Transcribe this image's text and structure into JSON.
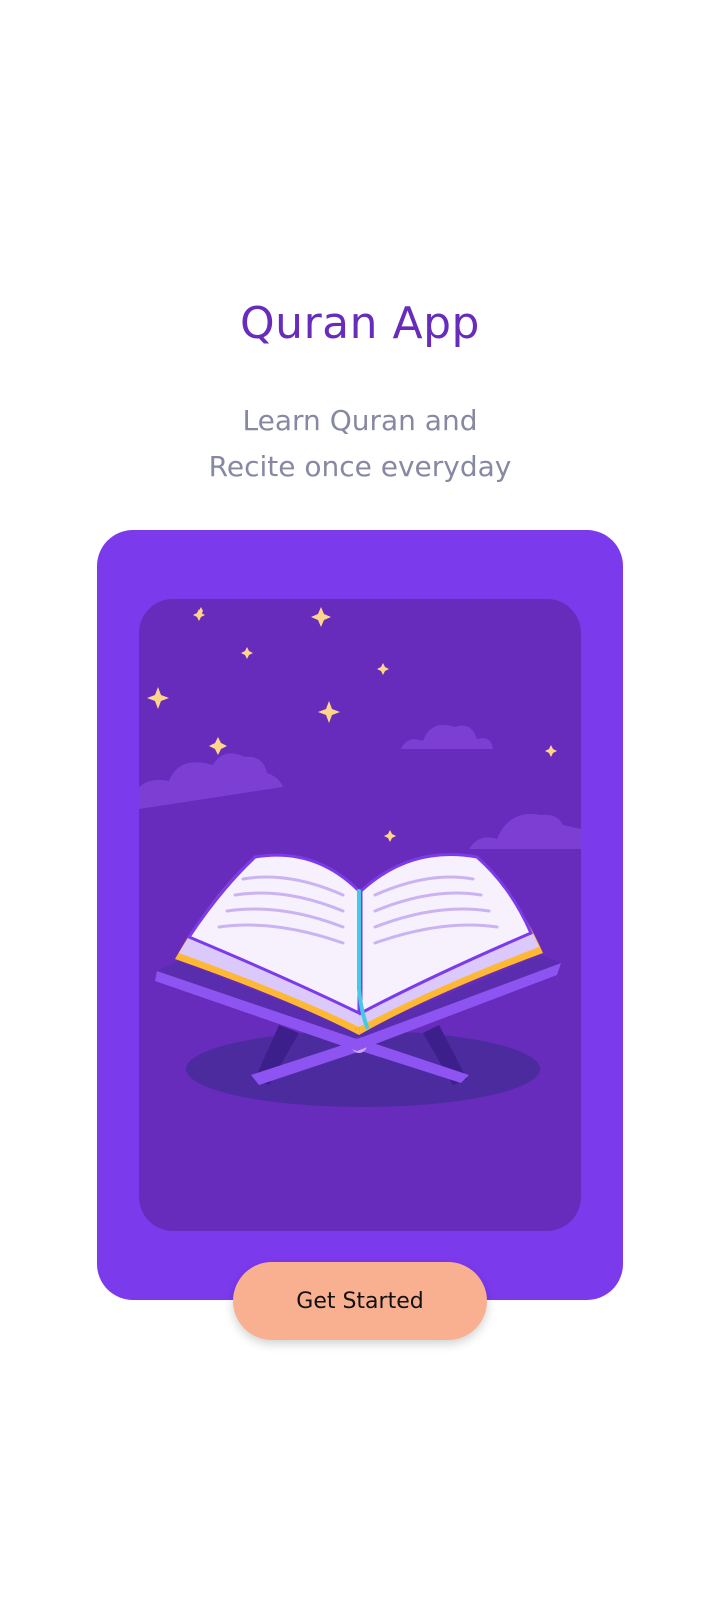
{
  "app": {
    "title": "Quran App",
    "subtitle_line1": "Learn Quran and",
    "subtitle_line2": "Recite once everyday"
  },
  "illustration": {
    "subject": "open-quran-on-stand",
    "icon": "quran-book-icon"
  },
  "cta": {
    "label": "Get Started"
  },
  "colors": {
    "title": "#672CBC",
    "subtitle": "#8789A3",
    "card": "#7C3AED",
    "card_inner": "#672CBC",
    "button": "#F9B091",
    "star": "#FFD58A"
  }
}
